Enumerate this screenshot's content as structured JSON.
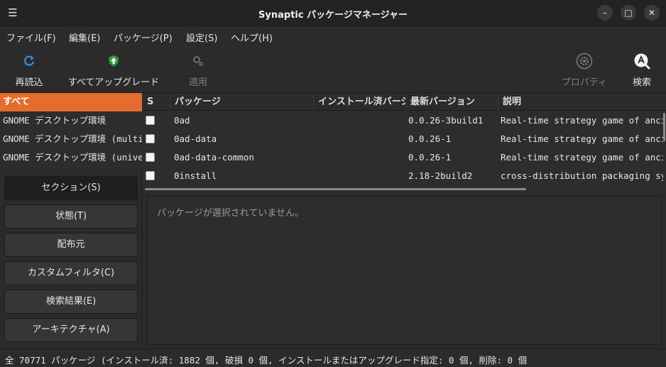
{
  "window": {
    "title": "Synaptic パッケージマネージャー",
    "menu_icon": "hamburger-icon",
    "controls": [
      "minimize-icon",
      "maximize-icon",
      "close-icon"
    ]
  },
  "menu": {
    "file": "ファイル(F)",
    "edit": "編集(E)",
    "package": "パッケージ(P)",
    "settings": "設定(S)",
    "help": "ヘルプ(H)"
  },
  "toolbar": {
    "reload": "再読込",
    "upgrade_all": "すべてアップグレード",
    "apply": "適用",
    "properties": "プロパティ",
    "search": "検索"
  },
  "filters": {
    "items": [
      "すべて",
      "GNOME デスクトップ環境",
      "GNOME デスクトップ環境 (multiverse)",
      "GNOME デスクトップ環境 (universe)"
    ],
    "selected_index": 0
  },
  "categories": {
    "section": "セクション(S)",
    "status": "状態(T)",
    "origin": "配布元",
    "custom": "カスタムフィルタ(C)",
    "search_results": "検索結果(E)",
    "architecture": "アーキテクチャ(A)",
    "active": "section"
  },
  "table": {
    "headers": {
      "s": "S",
      "package": "パッケージ",
      "installed_version": "インストール済バージョン",
      "latest_version": "最新バージョン",
      "description": "説明"
    },
    "rows": [
      {
        "checked": false,
        "package": "0ad",
        "installed": "",
        "latest": "0.0.26-3build1",
        "description": "Real-time strategy game of ancient warfare"
      },
      {
        "checked": false,
        "package": "0ad-data",
        "installed": "",
        "latest": "0.0.26-1",
        "description": "Real-time strategy game of ancient warfare (data files)"
      },
      {
        "checked": false,
        "package": "0ad-data-common",
        "installed": "",
        "latest": "0.0.26-1",
        "description": "Real-time strategy game of ancient warfare (common data files)"
      },
      {
        "checked": false,
        "package": "0install",
        "installed": "",
        "latest": "2.18-2build2",
        "description": "cross-distribution packaging system"
      }
    ]
  },
  "detail": {
    "message": "パッケージが選択されていません。"
  },
  "status": {
    "text": "全 70771 パッケージ (インストール済: 1882 個, 破損 0 個, インストールまたはアップグレード指定: 0 個, 削除: 0 個"
  },
  "colors": {
    "accent": "#e26d2e",
    "background": "#2b2b2b",
    "upgrade_icon": "#2e9e3a"
  }
}
